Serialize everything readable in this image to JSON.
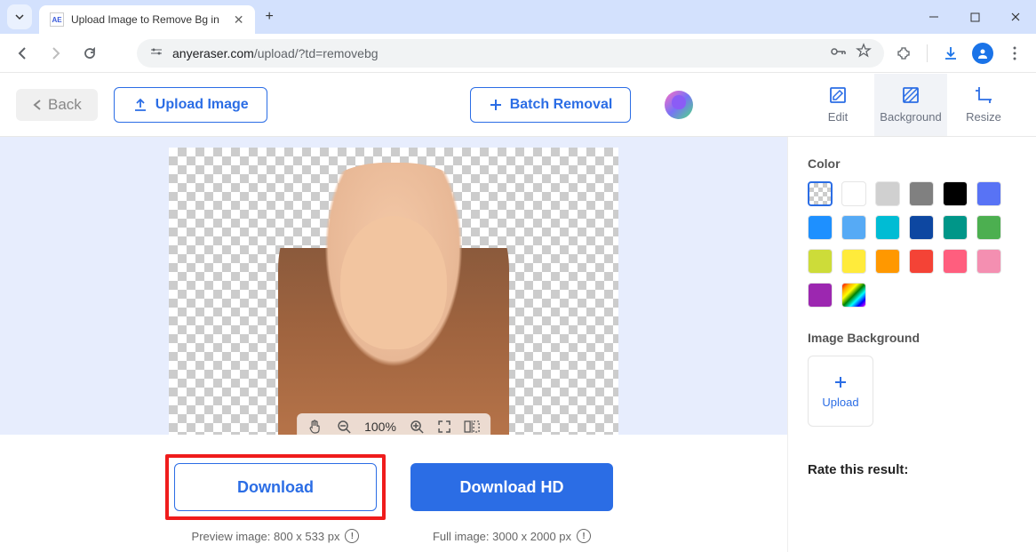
{
  "browser": {
    "tab_title": "Upload Image to Remove Bg in",
    "favicon_text": "AE",
    "url_prefix": "anyeraser.com",
    "url_path": "/upload/?td=removebg"
  },
  "toolbar": {
    "back_label": "Back",
    "upload_label": "Upload Image",
    "batch_label": "Batch Removal",
    "tabs": {
      "edit": "Edit",
      "background": "Background",
      "resize": "Resize"
    }
  },
  "canvas": {
    "zoom_value": "100%"
  },
  "downloads": {
    "standard_label": "Download",
    "hd_label": "Download HD",
    "preview_info": "Preview image: 800 x 533 px",
    "full_info": "Full image: 3000 x 2000 px"
  },
  "sidebar": {
    "color_label": "Color",
    "image_bg_label": "Image Background",
    "upload_label": "Upload",
    "rate_label": "Rate this result:",
    "colors_row1": [
      "transparent",
      "#ffffff",
      "#d0d0d0",
      "#808080",
      "#000000",
      "#5873f5"
    ],
    "colors_row2": [
      "#1e90ff",
      "#56aaf5",
      "#00bcd4",
      "#0d47a1",
      "#009688",
      "#4caf50"
    ],
    "colors_row3": [
      "#cddc39",
      "#ffeb3b",
      "#ff9800",
      "#f44336",
      "#ff5e7e",
      "#f48fb1"
    ],
    "colors_row4": [
      "#9c27b0",
      "rainbow"
    ]
  }
}
